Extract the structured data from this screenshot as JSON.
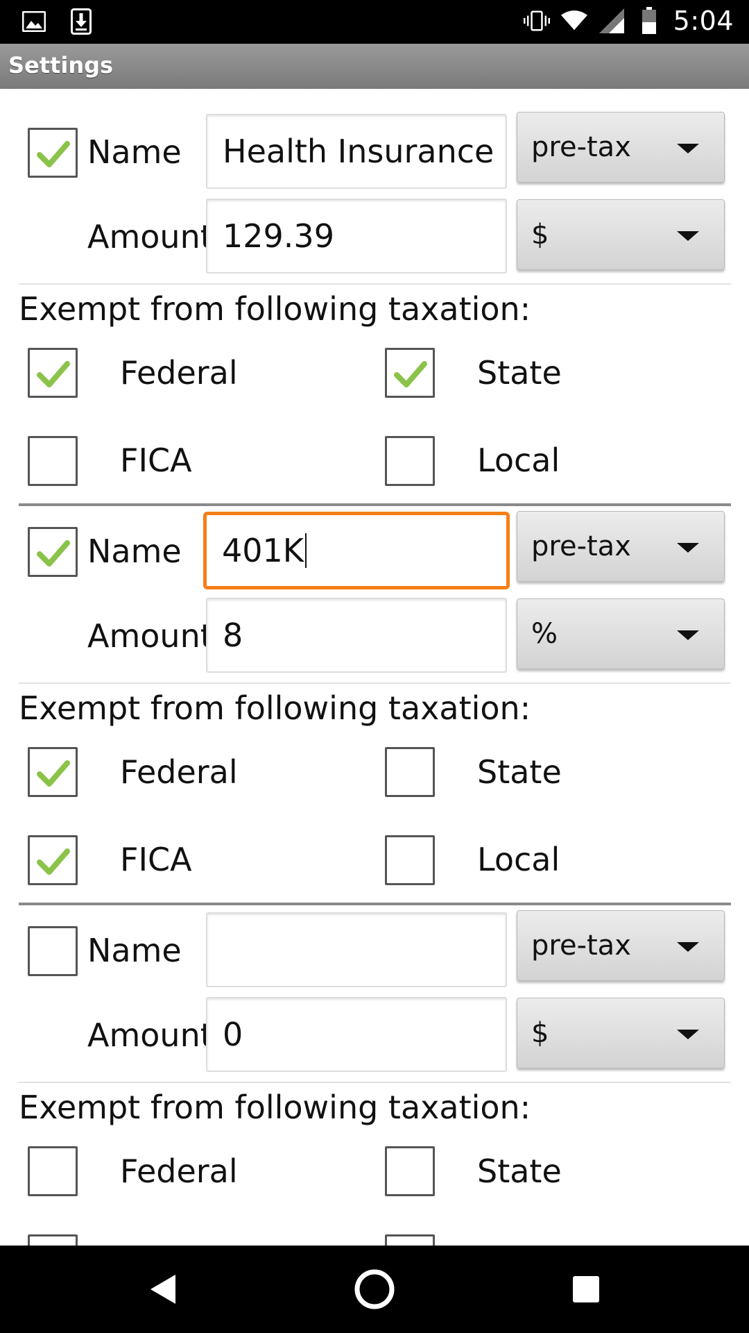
{
  "status_bar": {
    "time": "5:04",
    "left_icons": [
      "image-icon",
      "download-icon"
    ],
    "right_icons": [
      "vibrate-icon",
      "wifi-icon",
      "signal-icon",
      "battery-icon"
    ]
  },
  "title_bar": {
    "title": "Settings"
  },
  "labels": {
    "name": "Name",
    "amount": "Amount",
    "exempt_heading": "Exempt from following taxation:",
    "federal": "Federal",
    "state": "State",
    "fica": "FICA",
    "local": "Local"
  },
  "deductions": [
    {
      "enabled": true,
      "name_value": "Health Insurance",
      "type": "pre-tax",
      "amount_value": "129.39",
      "unit": "$",
      "exempt": {
        "federal": true,
        "state": true,
        "fica": false,
        "local": false
      }
    },
    {
      "enabled": true,
      "name_value": "401K",
      "name_focused": true,
      "type": "pre-tax",
      "amount_value": "8",
      "unit": "%",
      "exempt": {
        "federal": true,
        "state": false,
        "fica": true,
        "local": false
      }
    },
    {
      "enabled": false,
      "name_value": "",
      "type": "pre-tax",
      "amount_value": "0",
      "unit": "$",
      "exempt": {
        "federal": false,
        "state": false,
        "fica": false,
        "local": false
      }
    }
  ],
  "nav_bar": {
    "buttons": [
      "back-icon",
      "home-icon",
      "recents-icon"
    ]
  },
  "colors": {
    "check": "#8bc34a",
    "focus": "#f57f17",
    "title_bar": "#8a8a8a"
  }
}
